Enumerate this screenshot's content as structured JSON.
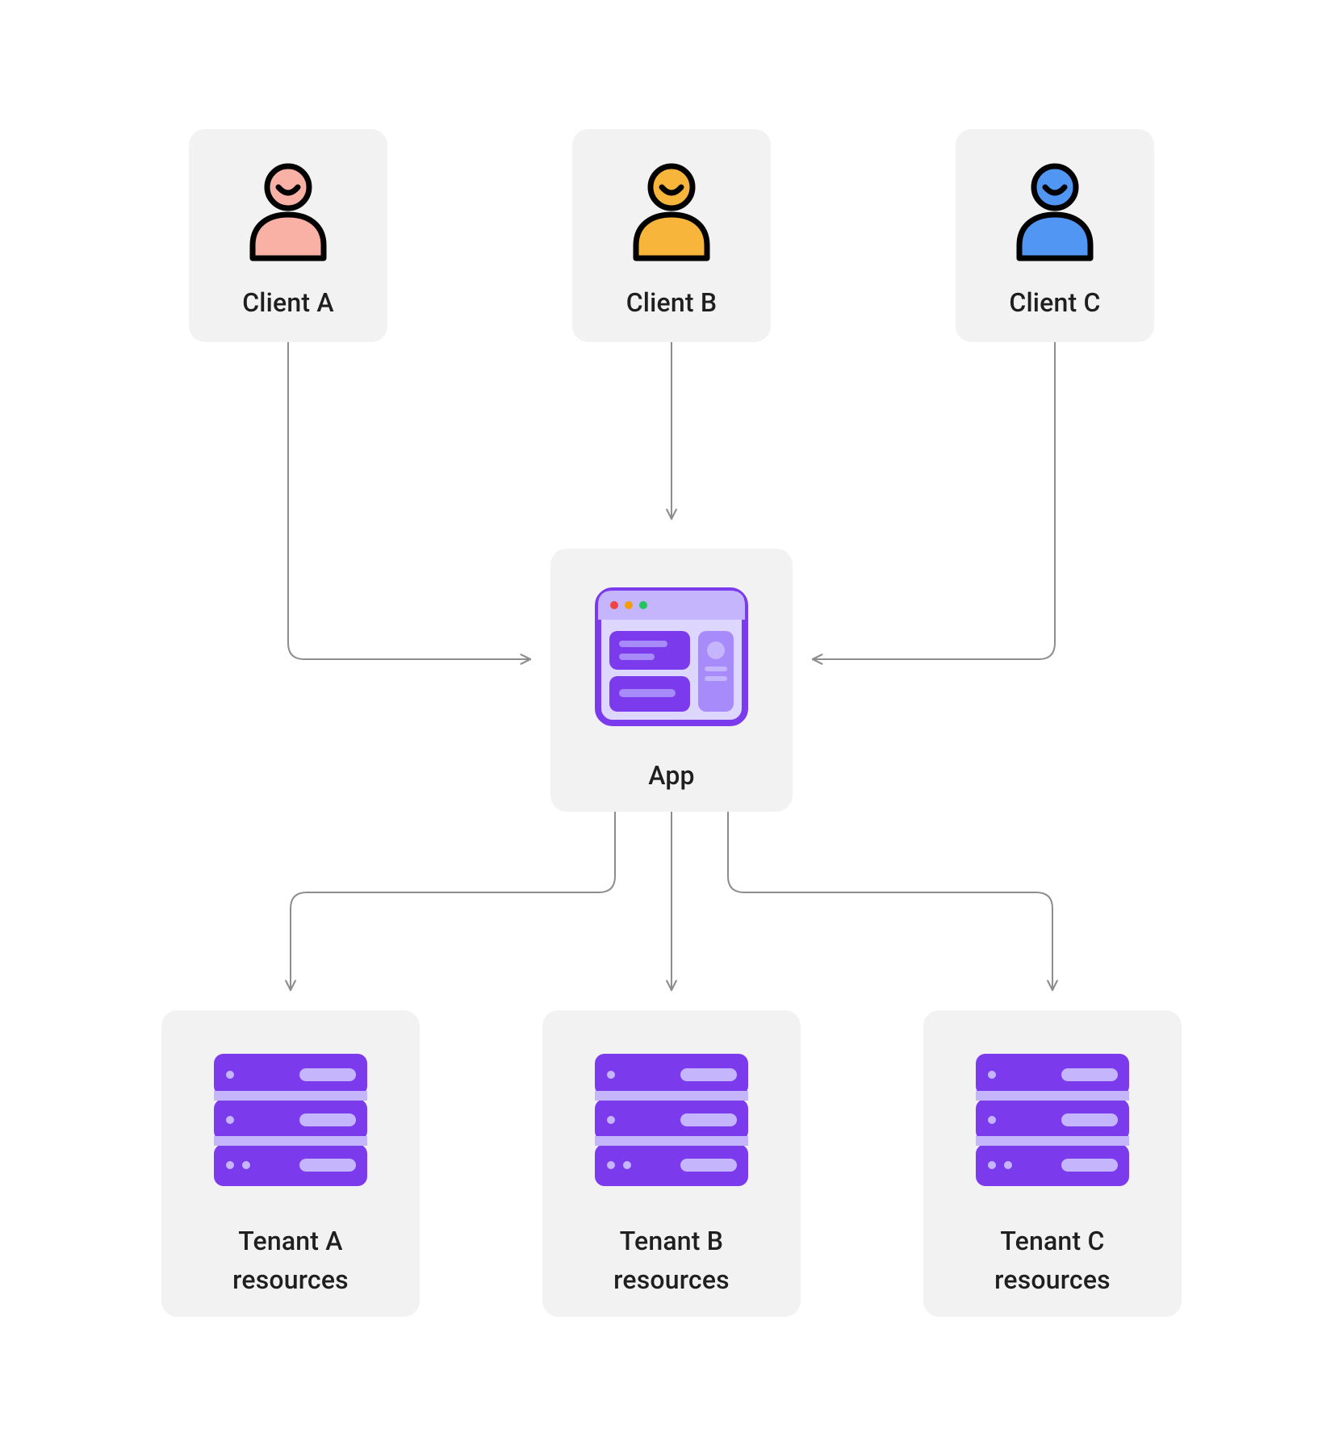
{
  "clients": [
    {
      "label": "Client A",
      "color": "#f9b1a5"
    },
    {
      "label": "Client B",
      "color": "#f7b53b"
    },
    {
      "label": "Client C",
      "color": "#5296f4"
    }
  ],
  "app": {
    "label": "App",
    "colors": {
      "dark": "#7c3aed",
      "mid": "#a78bfa",
      "light": "#c4b5fd",
      "bg": "#ddd6fe"
    }
  },
  "tenants": [
    {
      "label": "Tenant A\nresources"
    },
    {
      "label": "Tenant B\nresources"
    },
    {
      "label": "Tenant C\nresources"
    }
  ],
  "server_colors": {
    "dark": "#7c3aed",
    "light": "#c4b5fd"
  }
}
